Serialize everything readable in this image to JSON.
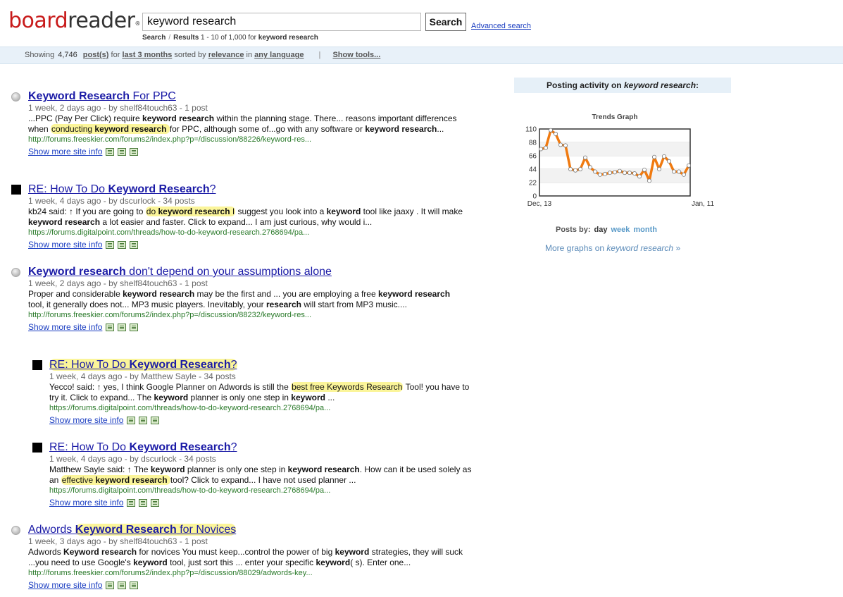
{
  "header": {
    "logo_board": "board",
    "logo_reader": "reader",
    "logo_reg": "®",
    "search_value": "keyword research",
    "search_button": "Search",
    "advanced_link": "Advanced search",
    "crumb_search": "Search",
    "crumb_sep": "/",
    "crumb_results": "Results",
    "crumb_detail": "1 - 10 of 1,000 for",
    "crumb_kw": "keyword research"
  },
  "infobar": {
    "showing": "Showing",
    "count": "4,746",
    "posts": "post(s)",
    "for": "for",
    "range": "last 3 months",
    "sorted": "sorted by",
    "sort": "relevance",
    "in": "in",
    "language": "any language",
    "pipe": "|",
    "tools": "Show tools..."
  },
  "results": [
    {
      "title_b": "Keyword Research",
      "title_rest": " For PPC",
      "meta": "1 week, 2 days ago - by shelf84touch63 - 1 post",
      "s1": "...PPC (Pay Per Click) require ",
      "s1b": "keyword research",
      "s2": " within the planning stage. There... reasons important differences when ",
      "s3hl1": "conducting ",
      "s3hlb": "keyword research",
      "s3hl2": " ",
      "s4": "for PPC, although some of...go with any software or ",
      "s4b": "keyword research",
      "s5": "...",
      "url": "http://forums.freeskier.com/forums2/index.php?p=/discussion/88226/keyword-res...",
      "tools": "Show more site info"
    },
    {
      "title_pre": "RE: How To Do ",
      "title_b": "Keyword Research",
      "title_rest": "?",
      "meta": "1 week, 4 days ago - by dscurlock - 34 posts",
      "s1": "kb24 said: ↑ If you are going to ",
      "hl1": "do ",
      "hlb": "keyword research",
      "hl2": " I",
      "s2": " suggest you look into a ",
      "s2b": "keyword",
      "s3": " tool like jaaxy . It will make ",
      "s3b": "keyword research",
      "s4": " a lot easier and faster. Click to expand... I am just curious, why would i...",
      "url": "https://forums.digitalpoint.com/threads/how-to-do-keyword-research.2768694/pa...",
      "tools": "Show more site info"
    },
    {
      "title_b": "Keyword research",
      "title_rest": " don't depend on your assumptions alone",
      "meta": "1 week, 2 days ago - by shelf84touch63 - 1 post",
      "s1": "Proper and considerable ",
      "s1b": "keyword research",
      "s2": " may be the first and ... you are employing a free ",
      "s2b": "keyword research",
      "s3": " tool, it generally does not... MP3 music players. Inevitably, your ",
      "s3b": "research",
      "s4": " will start from MP3 music....",
      "url": "http://forums.freeskier.com/forums2/index.php?p=/discussion/88232/keyword-res...",
      "tools": "Show more site info"
    },
    {
      "title_pre": "RE: How To Do ",
      "title_b": "Keyword Research",
      "title_rest": "?",
      "meta": "1 week, 4 days ago - by Matthew Sayle - 34 posts",
      "s1": "Yecco! said: ↑ yes, I think Google Planner on Adwords is still the ",
      "hl": "best free Keywords Research",
      "s2": " Tool! you have to try it. Click to expand... The ",
      "s2b": "keyword",
      "s3": " planner is only one step in ",
      "s3b": "keyword",
      "s4": " ...",
      "url": "https://forums.digitalpoint.com/threads/how-to-do-keyword-research.2768694/pa...",
      "tools": "Show more site info"
    },
    {
      "title_pre": "RE: How To Do ",
      "title_b": "Keyword Research",
      "title_rest": "?",
      "meta": "1 week, 4 days ago - by dscurlock - 34 posts",
      "s1": "Matthew Sayle said: ↑ The ",
      "s1b": "keyword",
      "s2": " planner is only one step in ",
      "s2b": "keyword research",
      "s3": ". How can it be used solely as an ",
      "hl1": "effective ",
      "hlb": "keyword research",
      "hl2": " ",
      "s4": "tool? Click to expand... I have not used planner ...",
      "url": "https://forums.digitalpoint.com/threads/how-to-do-keyword-research.2768694/pa...",
      "tools": "Show more site info"
    },
    {
      "title_pre": "Adwords ",
      "title_b": "Keyword Research",
      "title_rest": " for Novices",
      "meta": "1 week, 3 days ago - by shelf84touch63 - 1 post",
      "s1": "Adwords ",
      "s1b": "Keyword research",
      "s2": " for novices You must keep...control the power of big ",
      "s2b": "keyword",
      "s3": " strategies, they will suck ...you need to use Google's ",
      "s3b": "keyword",
      "s4": " tool, just sort this ... enter your specific ",
      "s4b": "keyword",
      "s5": "( s). Enter one...",
      "url": "http://forums.freeskier.com/forums2/index.php?p=/discussion/88029/adwords-key...",
      "tools": "Show more site info"
    }
  ],
  "panel": {
    "head_pre": "Posting activity on ",
    "head_kw": "keyword research",
    "head_post": ":",
    "posts_by": "Posts by:",
    "day": "day",
    "week": "week",
    "month": "month",
    "more_pre": "More graphs on ",
    "more_kw": "keyword research",
    "more_post": " »"
  },
  "chart_data": {
    "type": "line",
    "title": "Trends Graph",
    "x_start_label": "Dec, 13",
    "x_end_label": "Jan, 11",
    "yticks": [
      0,
      22,
      44,
      66,
      88,
      110
    ],
    "ylim": [
      0,
      110
    ],
    "color": "#f07a10",
    "grid": true,
    "values": [
      77,
      79,
      108,
      102,
      84,
      83,
      44,
      42,
      44,
      63,
      47,
      40,
      35,
      36,
      38,
      39,
      41,
      38,
      38,
      37,
      32,
      43,
      25,
      64,
      44,
      65,
      57,
      40,
      40,
      35,
      50
    ]
  }
}
